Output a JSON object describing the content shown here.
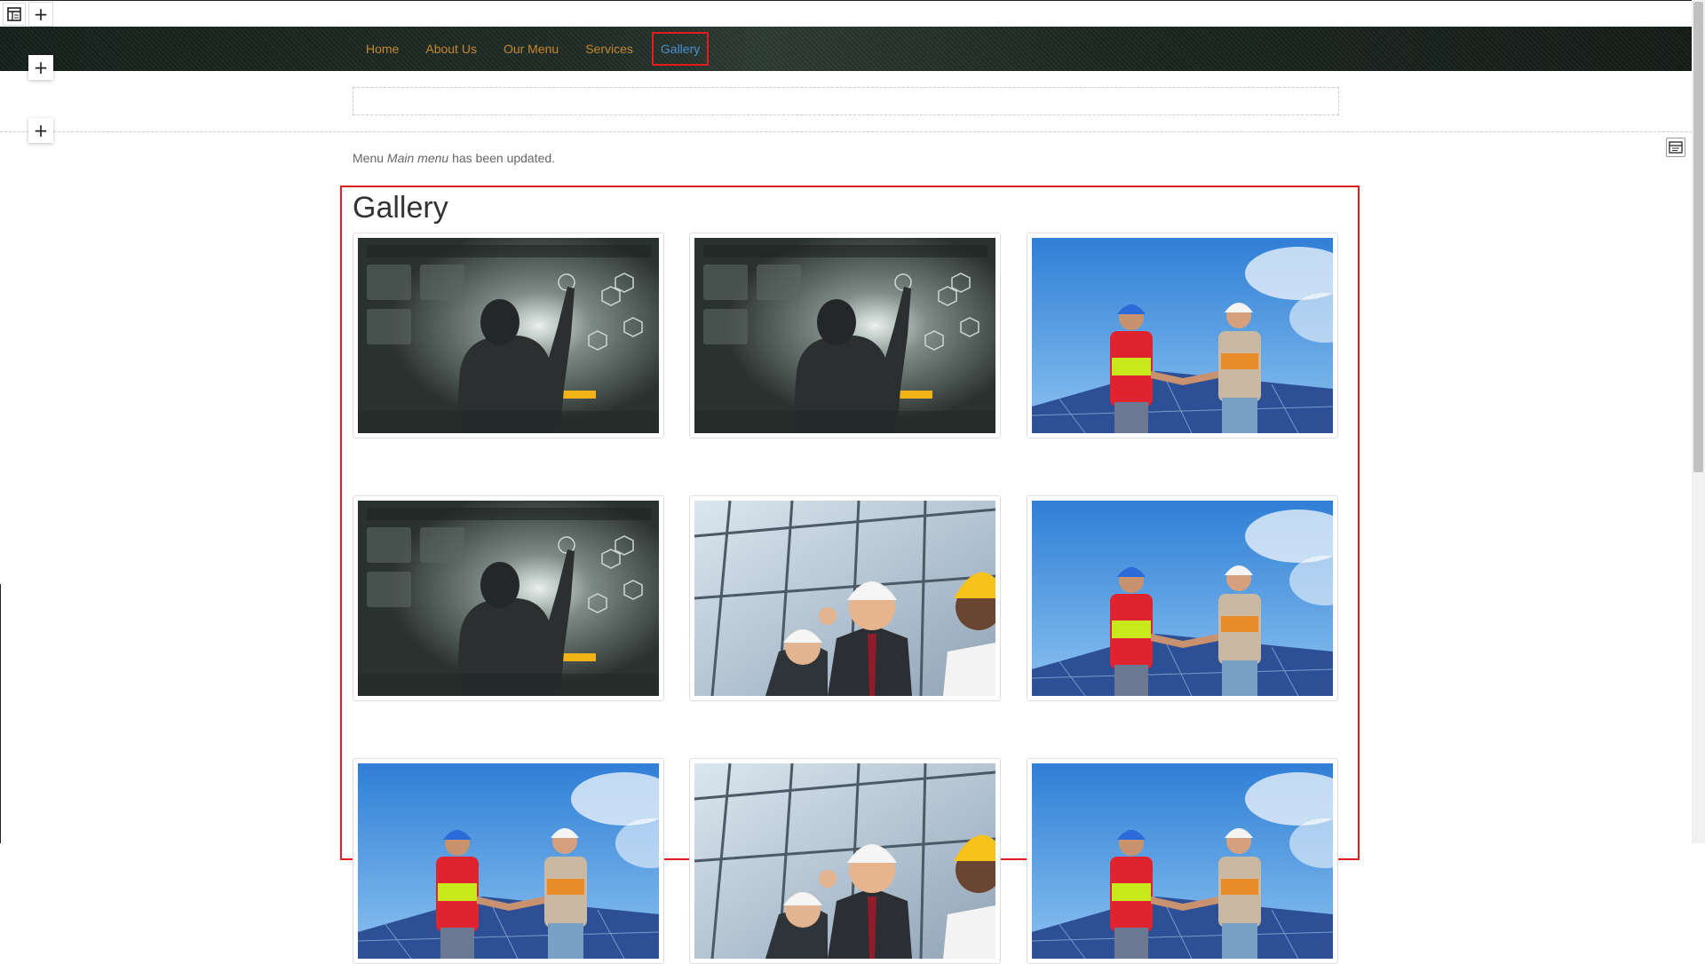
{
  "toolbar": {
    "layout_icon": "layout-builder-icon",
    "add_icon": "+"
  },
  "section_controls": {
    "add_label": "+"
  },
  "nav": {
    "items": [
      {
        "label": "Home"
      },
      {
        "label": "About Us"
      },
      {
        "label": "Our Menu"
      },
      {
        "label": "Services"
      },
      {
        "label": "Gallery",
        "active": true
      }
    ],
    "link_color": "#c6872f",
    "active_color": "#4f8fd0"
  },
  "status_message": {
    "prefix": "Menu",
    "menu_name": "Main menu",
    "suffix": "has been updated."
  },
  "gallery": {
    "title": "Gallery",
    "images": [
      {
        "subject": "businessman-touchscreen"
      },
      {
        "subject": "businessman-touchscreen"
      },
      {
        "subject": "workers-handshake-solar"
      },
      {
        "subject": "businessman-touchscreen"
      },
      {
        "subject": "happy-engineers-hardhats"
      },
      {
        "subject": "workers-handshake-solar"
      },
      {
        "subject": "workers-handshake-solar"
      },
      {
        "subject": "happy-engineers-hardhats"
      },
      {
        "subject": "workers-handshake-solar"
      }
    ]
  },
  "highlight_color": "#e21b1b"
}
